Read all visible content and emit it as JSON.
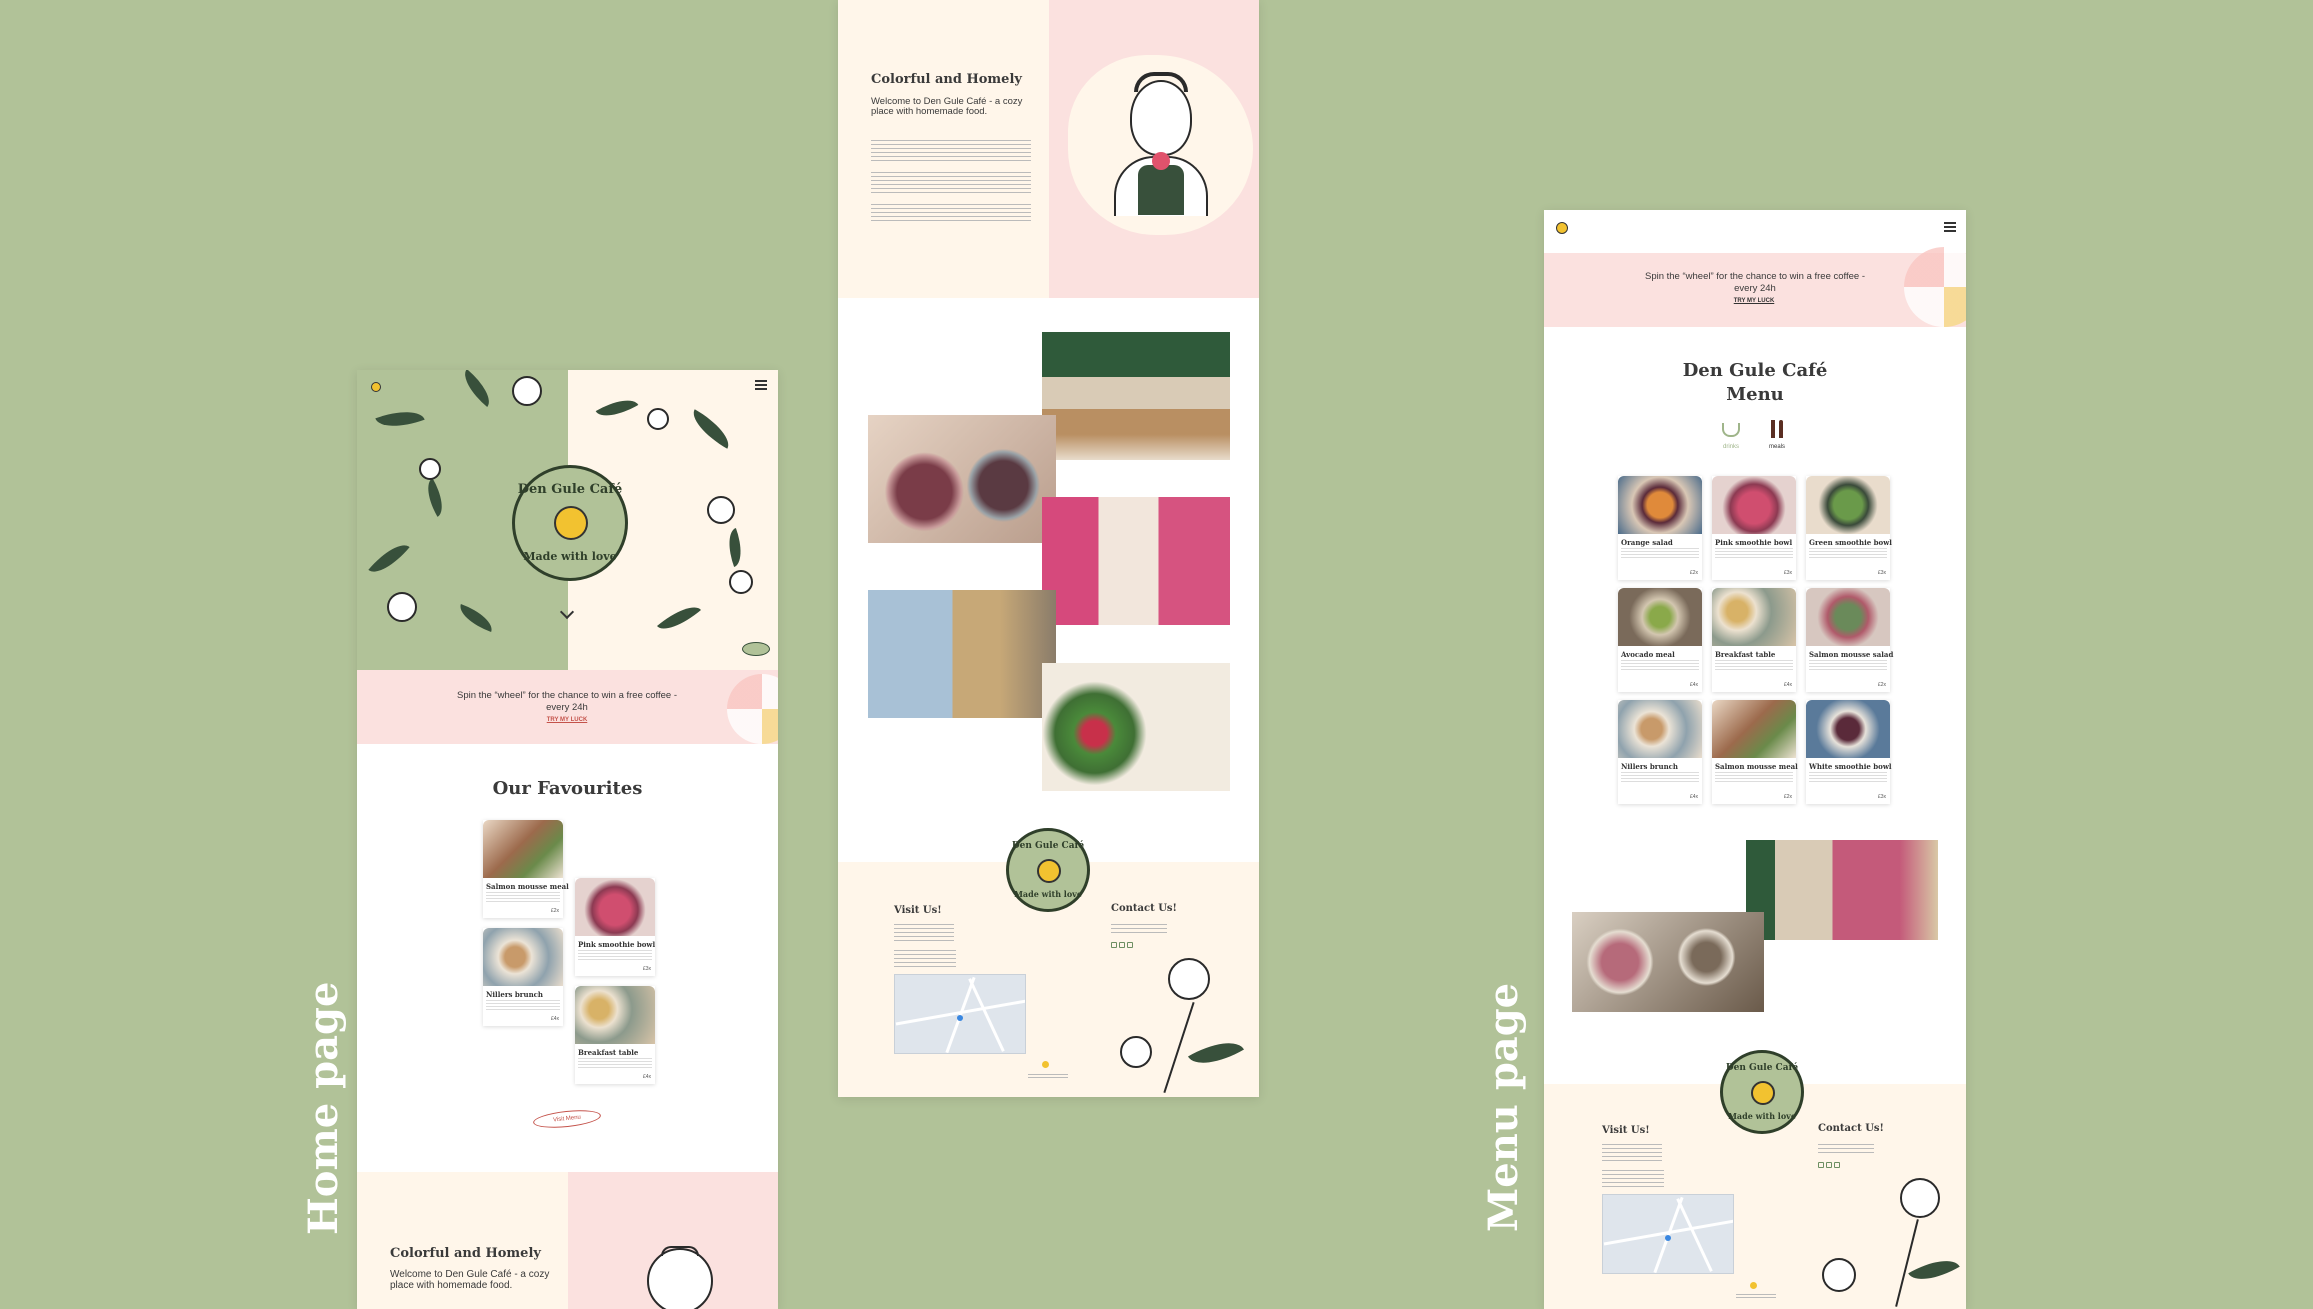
{
  "labels": {
    "home": "Home page",
    "menu": "Menu page"
  },
  "brand": {
    "logo_text_top": "Den Gule Café",
    "logo_text_bottom": "Made with love",
    "colors": {
      "background": "#b1c298",
      "pink": "#fbe1df",
      "cream": "#fff6ea",
      "dark_green": "#38503b",
      "yellow": "#f2c230"
    }
  },
  "home": {
    "promo_text": "Spin the “wheel” for the chance to win a free coffee - every 24h",
    "promo_link": "TRY MY LUCK",
    "favourites_title": "Our Favourites",
    "favourites": [
      {
        "name": "Salmon mousse meal",
        "price": "£2x"
      },
      {
        "name": "Pink smoothie bowl",
        "price": "£3x"
      },
      {
        "name": "Nillers brunch",
        "price": "£4x"
      },
      {
        "name": "Breakfast table",
        "price": "£4x"
      }
    ],
    "menu_button": "Visit Menu",
    "about_title": "Colorful and Homely",
    "about_lead": "Welcome to Den Gule Café - a cozy place with homemade food."
  },
  "about": {
    "title": "Colorful and Homely",
    "lead": "Welcome to Den Gule Café - a cozy place with homemade food."
  },
  "footer": {
    "visit_title": "Visit Us!",
    "contact_title": "Contact Us!"
  },
  "menu": {
    "promo_text": "Spin the “wheel” for the chance to win a free coffee - every 24h",
    "promo_link": "TRY MY LUCK",
    "title_line1": "Den Gule Café",
    "title_line2": "Menu",
    "tabs": [
      {
        "label": "drinks",
        "icon": "coffee-cup-icon"
      },
      {
        "label": "meals",
        "icon": "fork-knife-icon"
      }
    ],
    "items": [
      {
        "name": "Orange salad",
        "price": "£2x"
      },
      {
        "name": "Pink smoothie bowl",
        "price": "£3x"
      },
      {
        "name": "Green smoothie bowl",
        "price": "£3x"
      },
      {
        "name": "Avocado meal",
        "price": "£4x"
      },
      {
        "name": "Breakfast table",
        "price": "£4x"
      },
      {
        "name": "Salmon mousse salad",
        "price": "£2x"
      },
      {
        "name": "Nillers brunch",
        "price": "£4x"
      },
      {
        "name": "Salmon mousse meal",
        "price": "£2x"
      },
      {
        "name": "White smoothie bowl",
        "price": "£3x"
      }
    ]
  }
}
